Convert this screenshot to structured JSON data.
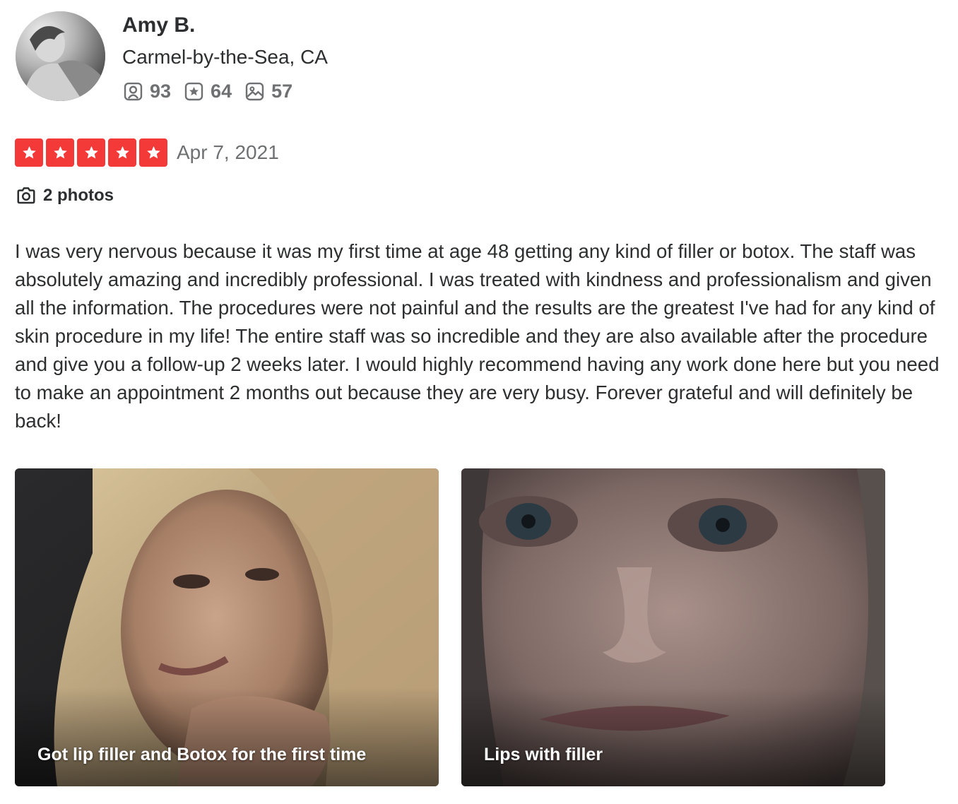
{
  "user": {
    "name": "Amy B.",
    "location": "Carmel-by-the-Sea, CA",
    "stats": {
      "friends": "93",
      "reviews": "64",
      "photos": "57"
    }
  },
  "review": {
    "rating": 5,
    "rating_max": 5,
    "date": "Apr 7, 2021",
    "photos_link_label": "2 photos",
    "text": "I was very nervous because it was my first time at age 48 getting any kind of filler or botox. The staff was absolutely amazing and incredibly professional. I was treated with kindness and professionalism and given all the information. The procedures were not painful and the results are the greatest I've had for any kind of skin procedure in my life! The entire staff was so incredible and they are also available after the procedure and give you a follow-up 2 weeks later. I would highly recommend having any work done here but you need to make an appointment 2 months out because they are very busy. Forever grateful and will definitely be back!"
  },
  "photos": [
    {
      "caption": "Got lip filler and Botox for the first time"
    },
    {
      "caption": "Lips with filler"
    }
  ],
  "colors": {
    "star_red": "#f43939",
    "text_primary": "#2d2e2f",
    "text_secondary": "#6e7072"
  },
  "icons": {
    "friends": "friends-icon",
    "reviews": "star-review-icon",
    "photos": "photo-icon",
    "camera": "camera-icon",
    "star": "star-icon"
  }
}
